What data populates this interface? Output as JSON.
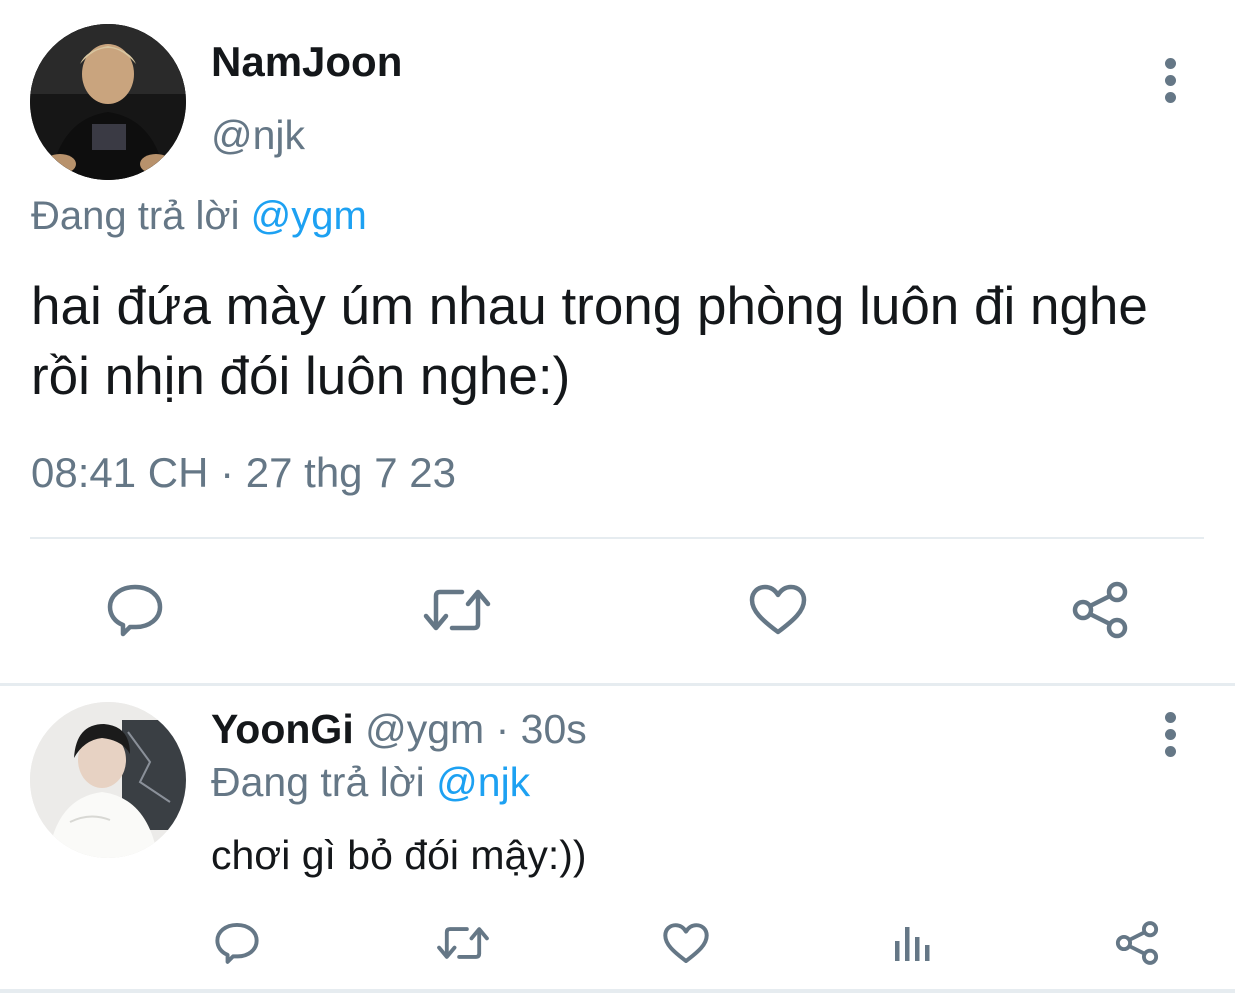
{
  "main_tweet": {
    "display_name": "NamJoon",
    "handle": "@njk",
    "reply_context_prefix": "Đang trả lời ",
    "reply_context_mention": "@ygm",
    "text": "hai đứa mày úm nhau trong phòng luôn đi nghe rồi nhịn đói luôn nghe:)",
    "timestamp": "08:41 CH · 27 thg 7 23",
    "actions": [
      "reply-icon",
      "retweet-icon",
      "like-icon",
      "share-icon"
    ]
  },
  "reply_tweet": {
    "display_name": "YoonGi",
    "meta": " @ygm · 30s",
    "reply_context_prefix": "Đang trả lời ",
    "reply_context_mention": "@njk",
    "text": "chơi gì bỏ đói mậy:))",
    "actions": [
      "reply-icon",
      "retweet-icon",
      "like-icon",
      "analytics-icon",
      "share-icon"
    ]
  },
  "colors": {
    "text_primary": "#14171a",
    "text_secondary": "#657786",
    "mention": "#1da1f2",
    "divider": "#e6ecf0"
  }
}
